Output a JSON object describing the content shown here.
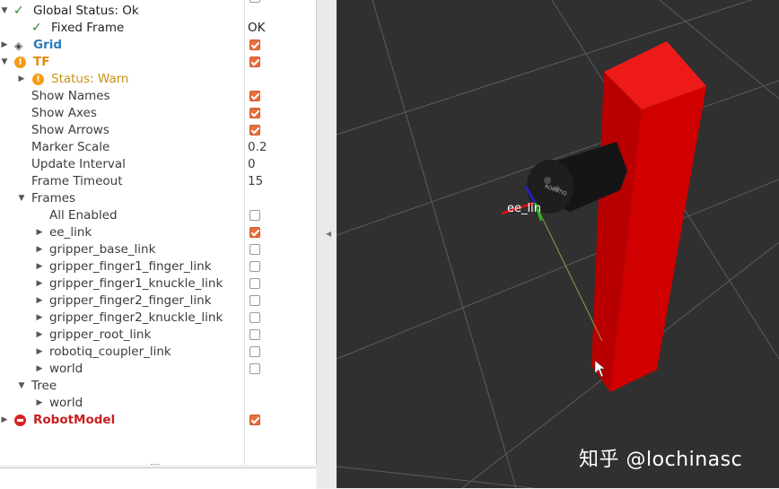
{
  "tree": {
    "global_status": {
      "label": "Global Status: Ok"
    },
    "fixed_frame": {
      "label": "Fixed Frame",
      "value": "OK"
    },
    "grid": {
      "label": "Grid",
      "enabled": true
    },
    "tf": {
      "label": "TF",
      "enabled": true,
      "status": "Status: Warn",
      "show_names": {
        "label": "Show Names",
        "checked": true
      },
      "show_axes": {
        "label": "Show Axes",
        "checked": true
      },
      "show_arrows": {
        "label": "Show Arrows",
        "checked": true
      },
      "marker_scale": {
        "label": "Marker Scale",
        "value": "0.2"
      },
      "update_interval": {
        "label": "Update Interval",
        "value": "0"
      },
      "frame_timeout": {
        "label": "Frame Timeout",
        "value": "15"
      },
      "frames": {
        "label": "Frames",
        "all_enabled": {
          "label": "All Enabled",
          "checked": false
        },
        "items": [
          {
            "label": "ee_link",
            "checked": true
          },
          {
            "label": "gripper_base_link",
            "checked": false
          },
          {
            "label": "gripper_finger1_finger_link",
            "checked": false
          },
          {
            "label": "gripper_finger1_knuckle_link",
            "checked": false
          },
          {
            "label": "gripper_finger2_finger_link",
            "checked": false
          },
          {
            "label": "gripper_finger2_knuckle_link",
            "checked": false
          },
          {
            "label": "gripper_root_link",
            "checked": false
          },
          {
            "label": "robotiq_coupler_link",
            "checked": false
          },
          {
            "label": "world",
            "checked": false
          }
        ]
      },
      "tree_node": {
        "label": "Tree",
        "child": "world"
      }
    },
    "robot_model": {
      "label": "RobotModel",
      "enabled": true
    }
  },
  "viewport": {
    "frame_label": "ee_lin",
    "gripper_text": "ROBOTIQ",
    "colors": {
      "background": "#303030",
      "pillar": "#d10000",
      "grid_line": "#5a5a5a"
    }
  },
  "watermark": "知乎 @lochinasc",
  "icons": {
    "ok": "check-icon",
    "warn": "warning-icon",
    "error": "error-icon",
    "grid": "grid-icon",
    "expand": "triangle-right-icon",
    "collapse": "triangle-down-icon",
    "panel_toggle": "triangle-left-icon"
  }
}
